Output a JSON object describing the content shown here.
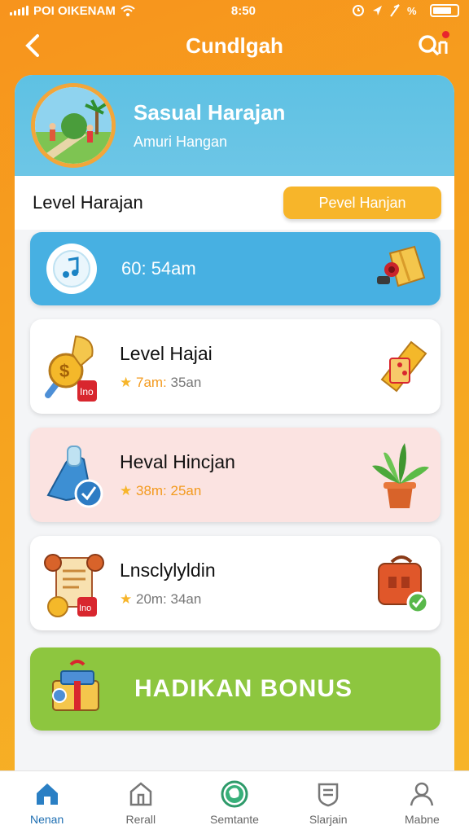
{
  "status_bar": {
    "carrier": "POI OIKENAM",
    "time": "8:50"
  },
  "header": {
    "title": "Cundlgah",
    "back_icon": "chevron-left-icon",
    "search_icon": "search-icon"
  },
  "profile": {
    "name": "Sasual Harajan",
    "subtitle": "Amuri Hangan"
  },
  "level": {
    "title": "Level Harajan",
    "button_label": "Pevel Hanjan"
  },
  "music": {
    "time": "60: 54am",
    "icon": "music-note-icon"
  },
  "items": [
    {
      "title": "Level Hajai",
      "time": "7am:",
      "duration": "35an",
      "icon": "coin-key-icon",
      "right_icon": "ticket-icon"
    },
    {
      "title": "Heval Hincjan",
      "time": "38m:",
      "duration": "25an",
      "icon": "bottle-icon",
      "right_icon": "plant-icon"
    },
    {
      "title": "Lnsclylyldin",
      "time": "20m:",
      "duration": "34an",
      "icon": "scroll-icon",
      "right_icon": "bag-icon"
    }
  ],
  "bonus": {
    "label": "HADIKAN BONUS",
    "icon": "gift-box-icon"
  },
  "bottom_nav": [
    {
      "label": "Nenan",
      "icon": "home-icon",
      "active": true
    },
    {
      "label": "Rerall",
      "icon": "building-icon",
      "active": false
    },
    {
      "label": "Semtante",
      "icon": "globe-icon",
      "active": false
    },
    {
      "label": "Slarjain",
      "icon": "shield-icon",
      "active": false
    },
    {
      "label": "Mabne",
      "icon": "user-icon",
      "active": false
    }
  ],
  "colors": {
    "orange_bg": "#f7941d",
    "profile_blue": "#5ec1e3",
    "music_blue": "#47b0e2",
    "accent_yellow": "#f7b52a",
    "bonus_green": "#8dc63f",
    "pink_card": "#fbe3e1",
    "nav_active": "#1f6fb2"
  }
}
